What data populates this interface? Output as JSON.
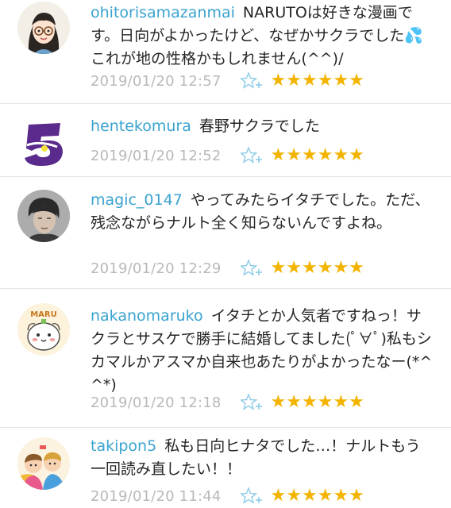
{
  "comments": [
    {
      "username": "ohitorisamazanmai",
      "text": "NARUTOは好きな漫画です。日向がよかったけど、なぜかサクラでした💦これが地の性格かもしれません(^^)/",
      "timestamp": "2019/01/20 12:57",
      "rating": "★★★★★★",
      "avatar_icon": "girl-with-glasses-avatar"
    },
    {
      "username": "hentekomura",
      "text": "春野サクラでした",
      "timestamp": "2019/01/20 12:52",
      "rating": "★★★★★★",
      "avatar_icon": "purple-number-five-avatar"
    },
    {
      "username": "magic_0147",
      "text": "やってみたらイタチでした。ただ、残念ながらナルト全く知らないんですよね。",
      "timestamp": "2019/01/20 12:29",
      "rating": "★★★★★★",
      "avatar_icon": "man-photo-avatar"
    },
    {
      "username": "nakanomaruko",
      "text": "イタチとか人気者ですねっ！サクラとサスケで勝手に結婚してました(ﾟ∀ﾟ)私もシカマルかアスマか自来也あたりがよかったなー(*^^*)",
      "timestamp": "2019/01/20 12:18",
      "rating": "★★★★★★",
      "avatar_icon": "maru-character-avatar"
    },
    {
      "username": "takipon5",
      "text": "私も日向ヒナタでした…！ナルトもう一回読み直したい！！",
      "timestamp": "2019/01/20 11:44",
      "rating": "★★★★★★",
      "avatar_icon": "kids-illustration-avatar"
    }
  ],
  "colors": {
    "username": "#3aa3cf",
    "timestamp": "#b9b9b9",
    "star": "#f3b400",
    "fav_icon": "#8ccbe8"
  }
}
